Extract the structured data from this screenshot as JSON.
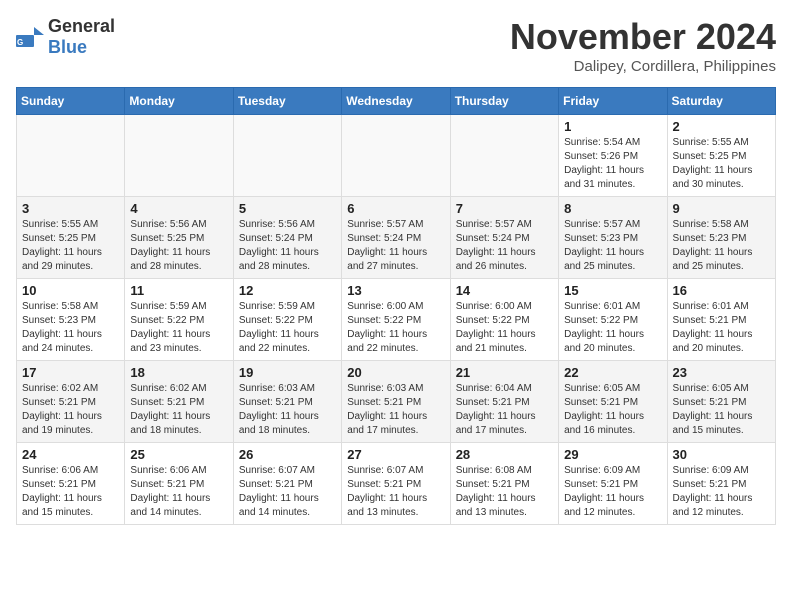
{
  "header": {
    "logo_general": "General",
    "logo_blue": "Blue",
    "month": "November 2024",
    "location": "Dalipey, Cordillera, Philippines"
  },
  "weekdays": [
    "Sunday",
    "Monday",
    "Tuesday",
    "Wednesday",
    "Thursday",
    "Friday",
    "Saturday"
  ],
  "weeks": [
    [
      {
        "day": "",
        "info": ""
      },
      {
        "day": "",
        "info": ""
      },
      {
        "day": "",
        "info": ""
      },
      {
        "day": "",
        "info": ""
      },
      {
        "day": "",
        "info": ""
      },
      {
        "day": "1",
        "info": "Sunrise: 5:54 AM\nSunset: 5:26 PM\nDaylight: 11 hours\nand 31 minutes."
      },
      {
        "day": "2",
        "info": "Sunrise: 5:55 AM\nSunset: 5:25 PM\nDaylight: 11 hours\nand 30 minutes."
      }
    ],
    [
      {
        "day": "3",
        "info": "Sunrise: 5:55 AM\nSunset: 5:25 PM\nDaylight: 11 hours\nand 29 minutes."
      },
      {
        "day": "4",
        "info": "Sunrise: 5:56 AM\nSunset: 5:25 PM\nDaylight: 11 hours\nand 28 minutes."
      },
      {
        "day": "5",
        "info": "Sunrise: 5:56 AM\nSunset: 5:24 PM\nDaylight: 11 hours\nand 28 minutes."
      },
      {
        "day": "6",
        "info": "Sunrise: 5:57 AM\nSunset: 5:24 PM\nDaylight: 11 hours\nand 27 minutes."
      },
      {
        "day": "7",
        "info": "Sunrise: 5:57 AM\nSunset: 5:24 PM\nDaylight: 11 hours\nand 26 minutes."
      },
      {
        "day": "8",
        "info": "Sunrise: 5:57 AM\nSunset: 5:23 PM\nDaylight: 11 hours\nand 25 minutes."
      },
      {
        "day": "9",
        "info": "Sunrise: 5:58 AM\nSunset: 5:23 PM\nDaylight: 11 hours\nand 25 minutes."
      }
    ],
    [
      {
        "day": "10",
        "info": "Sunrise: 5:58 AM\nSunset: 5:23 PM\nDaylight: 11 hours\nand 24 minutes."
      },
      {
        "day": "11",
        "info": "Sunrise: 5:59 AM\nSunset: 5:22 PM\nDaylight: 11 hours\nand 23 minutes."
      },
      {
        "day": "12",
        "info": "Sunrise: 5:59 AM\nSunset: 5:22 PM\nDaylight: 11 hours\nand 22 minutes."
      },
      {
        "day": "13",
        "info": "Sunrise: 6:00 AM\nSunset: 5:22 PM\nDaylight: 11 hours\nand 22 minutes."
      },
      {
        "day": "14",
        "info": "Sunrise: 6:00 AM\nSunset: 5:22 PM\nDaylight: 11 hours\nand 21 minutes."
      },
      {
        "day": "15",
        "info": "Sunrise: 6:01 AM\nSunset: 5:22 PM\nDaylight: 11 hours\nand 20 minutes."
      },
      {
        "day": "16",
        "info": "Sunrise: 6:01 AM\nSunset: 5:21 PM\nDaylight: 11 hours\nand 20 minutes."
      }
    ],
    [
      {
        "day": "17",
        "info": "Sunrise: 6:02 AM\nSunset: 5:21 PM\nDaylight: 11 hours\nand 19 minutes."
      },
      {
        "day": "18",
        "info": "Sunrise: 6:02 AM\nSunset: 5:21 PM\nDaylight: 11 hours\nand 18 minutes."
      },
      {
        "day": "19",
        "info": "Sunrise: 6:03 AM\nSunset: 5:21 PM\nDaylight: 11 hours\nand 18 minutes."
      },
      {
        "day": "20",
        "info": "Sunrise: 6:03 AM\nSunset: 5:21 PM\nDaylight: 11 hours\nand 17 minutes."
      },
      {
        "day": "21",
        "info": "Sunrise: 6:04 AM\nSunset: 5:21 PM\nDaylight: 11 hours\nand 17 minutes."
      },
      {
        "day": "22",
        "info": "Sunrise: 6:05 AM\nSunset: 5:21 PM\nDaylight: 11 hours\nand 16 minutes."
      },
      {
        "day": "23",
        "info": "Sunrise: 6:05 AM\nSunset: 5:21 PM\nDaylight: 11 hours\nand 15 minutes."
      }
    ],
    [
      {
        "day": "24",
        "info": "Sunrise: 6:06 AM\nSunset: 5:21 PM\nDaylight: 11 hours\nand 15 minutes."
      },
      {
        "day": "25",
        "info": "Sunrise: 6:06 AM\nSunset: 5:21 PM\nDaylight: 11 hours\nand 14 minutes."
      },
      {
        "day": "26",
        "info": "Sunrise: 6:07 AM\nSunset: 5:21 PM\nDaylight: 11 hours\nand 14 minutes."
      },
      {
        "day": "27",
        "info": "Sunrise: 6:07 AM\nSunset: 5:21 PM\nDaylight: 11 hours\nand 13 minutes."
      },
      {
        "day": "28",
        "info": "Sunrise: 6:08 AM\nSunset: 5:21 PM\nDaylight: 11 hours\nand 13 minutes."
      },
      {
        "day": "29",
        "info": "Sunrise: 6:09 AM\nSunset: 5:21 PM\nDaylight: 11 hours\nand 12 minutes."
      },
      {
        "day": "30",
        "info": "Sunrise: 6:09 AM\nSunset: 5:21 PM\nDaylight: 11 hours\nand 12 minutes."
      }
    ]
  ]
}
